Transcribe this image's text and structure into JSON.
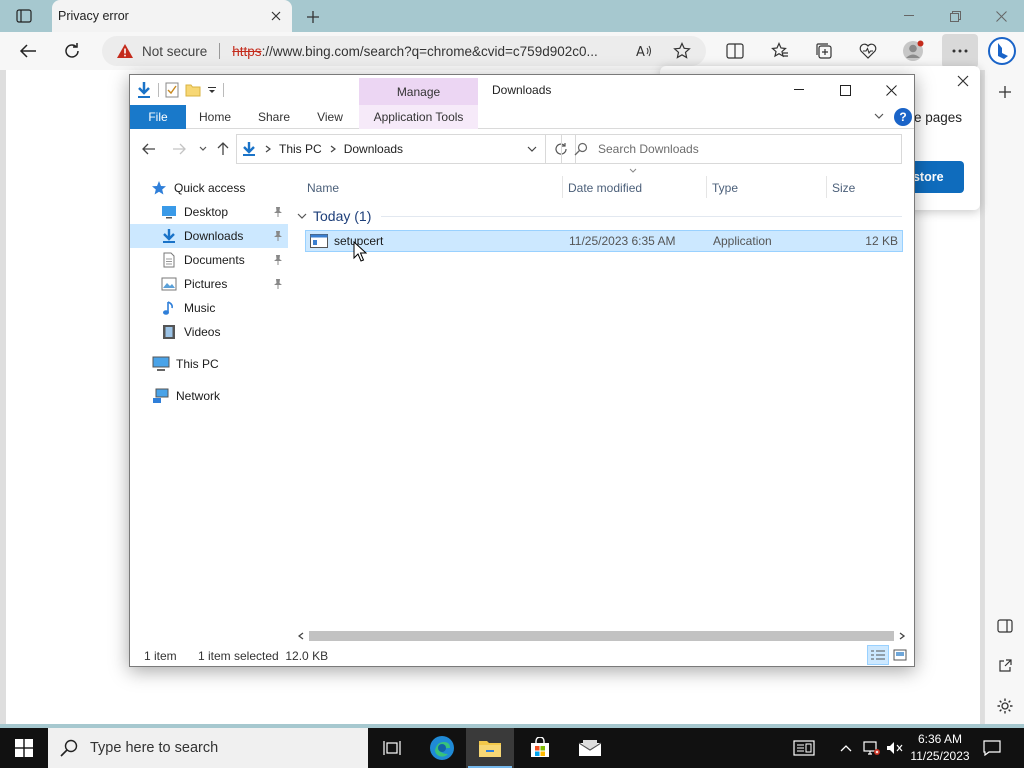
{
  "browser": {
    "tab_title": "Privacy error",
    "not_secure_label": "Not secure",
    "url_scheme": "https",
    "url_rest": "://www.bing.com/search?q=chrome&cvid=c759d902c0...",
    "popup_text": "e pages",
    "popup_button": "estore"
  },
  "explorer": {
    "title": "Downloads",
    "contextual_group": "Manage",
    "ribbon_tabs": [
      "File",
      "Home",
      "Share",
      "View",
      "Application Tools"
    ],
    "breadcrumb": [
      "This PC",
      "Downloads"
    ],
    "search_placeholder": "Search Downloads",
    "nav": {
      "quick_access": "Quick access",
      "desktop": "Desktop",
      "downloads": "Downloads",
      "documents": "Documents",
      "pictures": "Pictures",
      "music": "Music",
      "videos": "Videos",
      "this_pc": "This PC",
      "network": "Network"
    },
    "columns": {
      "name": "Name",
      "date": "Date modified",
      "type": "Type",
      "size": "Size"
    },
    "group_label": "Today (1)",
    "files": [
      {
        "name": "setupcert",
        "date": "11/25/2023 6:35 AM",
        "type": "Application",
        "size": "12 KB"
      }
    ],
    "status": {
      "count": "1 item",
      "selected": "1 item selected  12.0 KB"
    }
  },
  "taskbar": {
    "search_placeholder": "Type here to search",
    "time": "6:36 AM",
    "date": "11/25/2023"
  },
  "colors": {
    "file_tab": "#1979ca",
    "manage_tab": "#ecd6f3",
    "selection": "#cce8ff",
    "edge_button": "#0f6cbd"
  }
}
